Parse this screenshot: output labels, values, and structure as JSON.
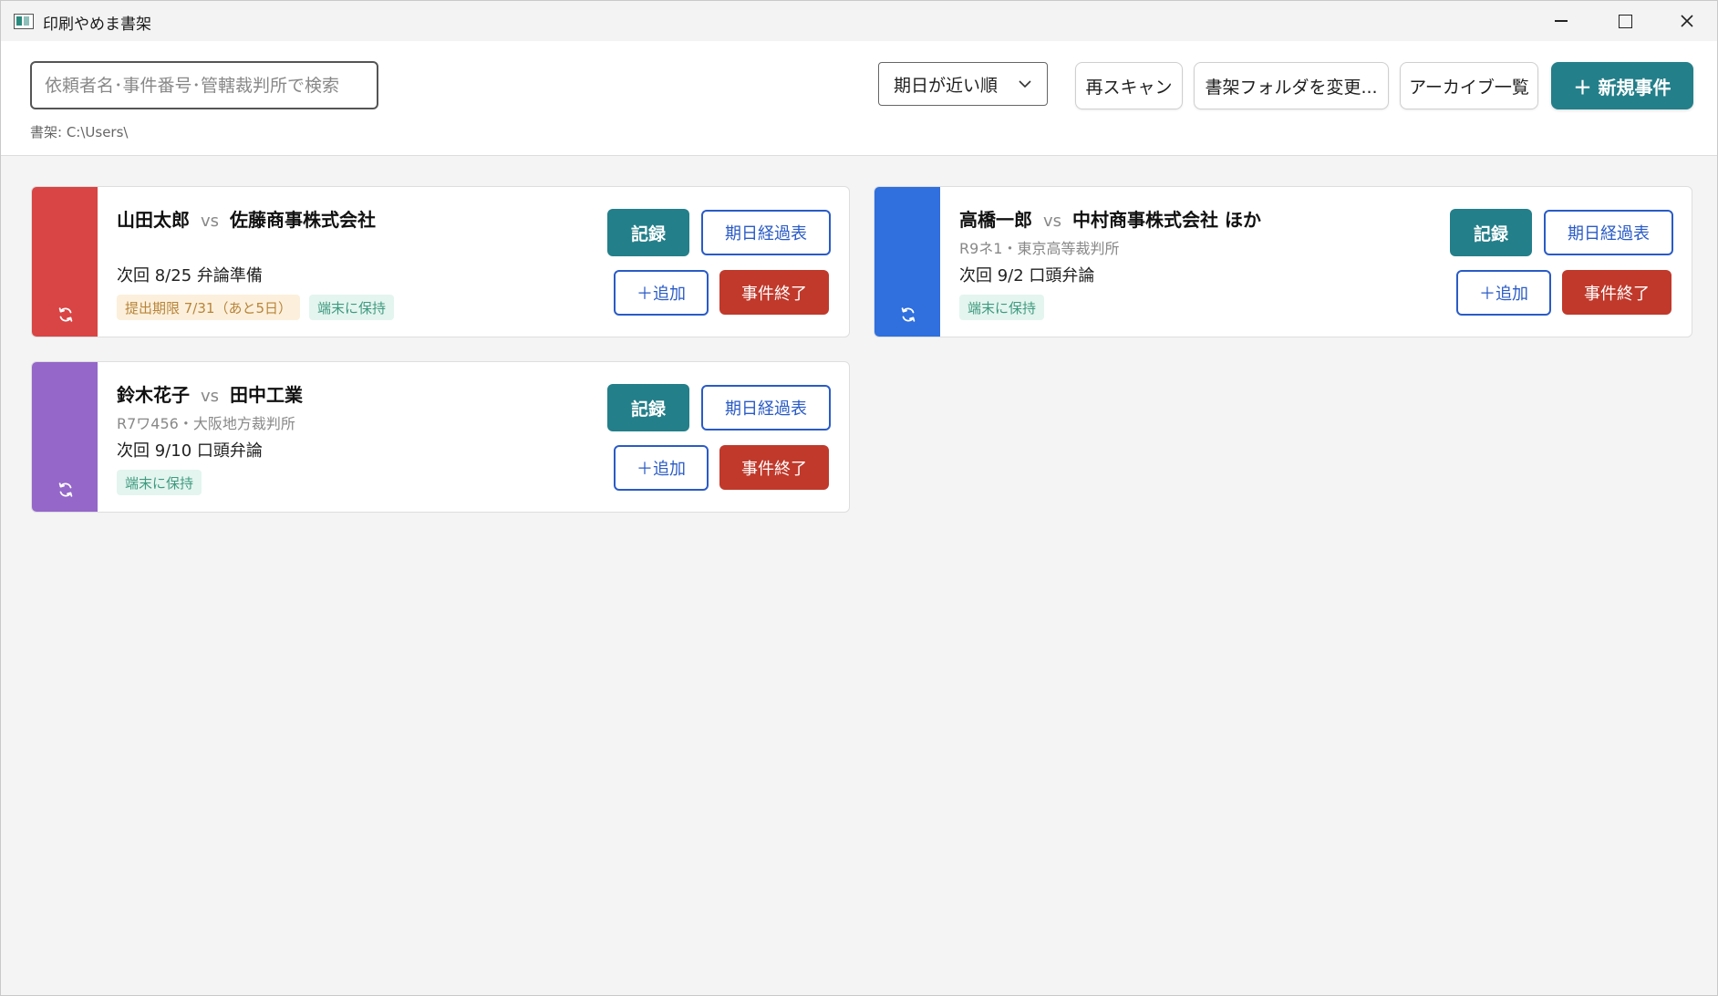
{
  "window": {
    "title": "印刷やめま書架"
  },
  "toolbar": {
    "search_placeholder": "依頼者名･事件番号･管轄裁判所で検索",
    "shelf_path": "書架: C:\\Users\\",
    "sort_selected": "期日が近い順",
    "rescan_label": "再スキャン",
    "change_folder_label": "書架フォルダを変更...",
    "archive_label": "アーカイブ一覧",
    "new_case_label": "＋ 新規事件"
  },
  "colors": {
    "accent": "#237f8a",
    "danger": "#c0392b",
    "link_blue": "#2a5bc6"
  },
  "cases": [
    {
      "client": "山田太郎",
      "vs": "vs",
      "opponent": "佐藤商事株式会社",
      "meta": "",
      "next": "次回 8/25 弁論準備",
      "strip_color": "#d94444",
      "tags": [
        {
          "label": "提出期限 7/31（あと5日）",
          "kind": "warn"
        },
        {
          "label": "端末に保持",
          "kind": "keep"
        }
      ],
      "buttons": {
        "record": "記録",
        "timeline": "期日経過表",
        "add": "＋追加",
        "close": "事件終了"
      }
    },
    {
      "client": "高橋一郎",
      "vs": "vs",
      "opponent": "中村商事株式会社 ほか",
      "meta": "R9ネ1・東京高等裁判所",
      "next": "次回 9/2 口頭弁論",
      "strip_color": "#2f6fde",
      "tags": [
        {
          "label": "端末に保持",
          "kind": "keep"
        }
      ],
      "buttons": {
        "record": "記録",
        "timeline": "期日経過表",
        "add": "＋追加",
        "close": "事件終了"
      }
    },
    {
      "client": "鈴木花子",
      "vs": "vs",
      "opponent": "田中工業",
      "meta": "R7ワ456・大阪地方裁判所",
      "next": "次回 9/10 口頭弁論",
      "strip_color": "#9467c9",
      "tags": [
        {
          "label": "端末に保持",
          "kind": "keep"
        }
      ],
      "buttons": {
        "record": "記録",
        "timeline": "期日経過表",
        "add": "＋追加",
        "close": "事件終了"
      }
    }
  ]
}
